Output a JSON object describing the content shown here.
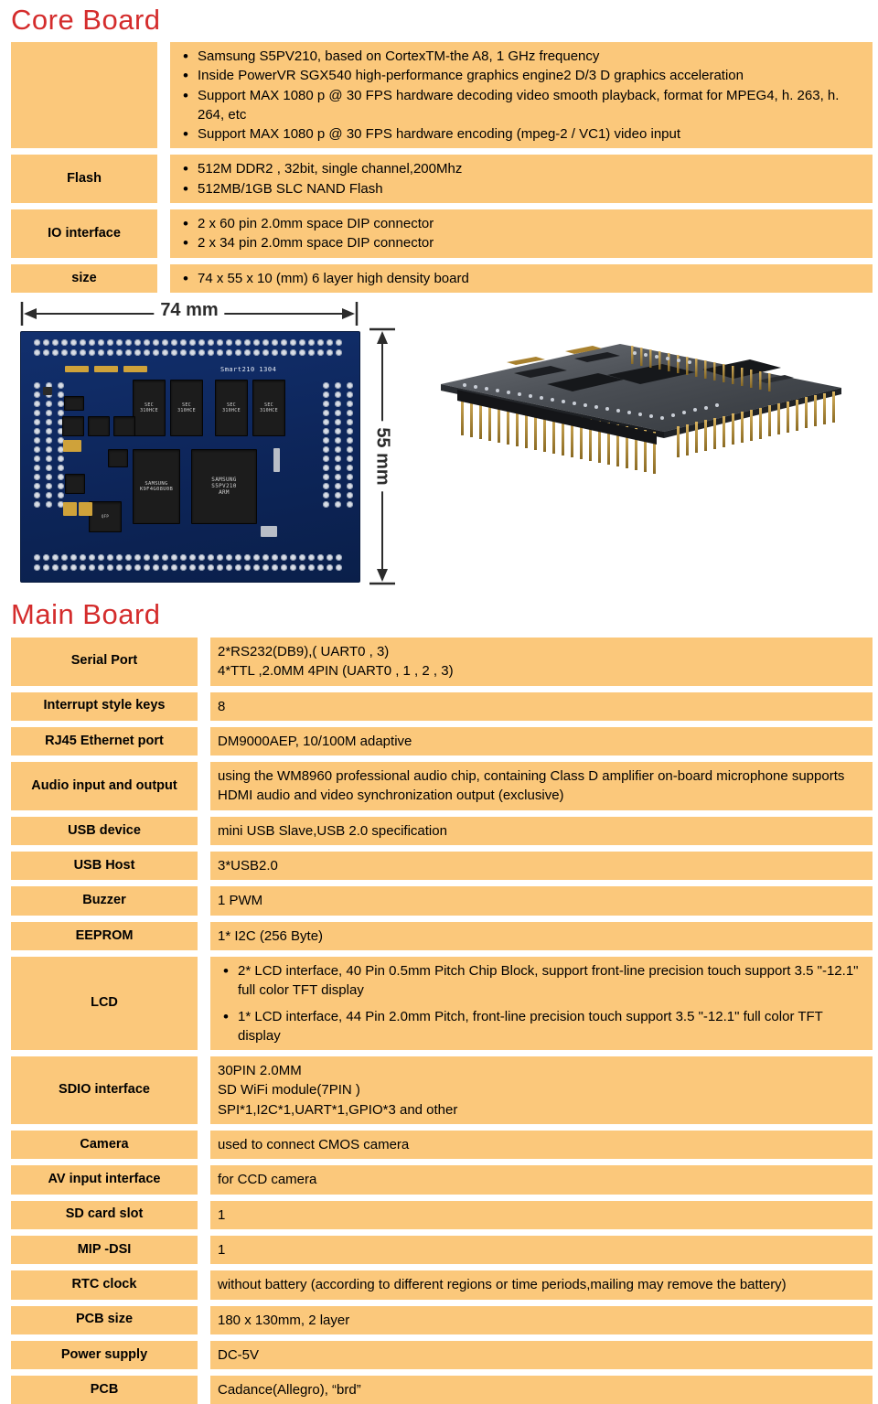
{
  "core_board": {
    "title": "Core Board",
    "rows": [
      {
        "label": "",
        "bullets": [
          "Samsung S5PV210, based on CortexTM-the A8, 1 GHz frequency",
          "Inside PowerVR SGX540 high-performance graphics engine2 D/3 D graphics acceleration",
          "Support MAX 1080 p @ 30 FPS hardware decoding video smooth playback, format for MPEG4, h. 263, h. 264, etc",
          "Support MAX 1080 p @ 30 FPS hardware encoding (mpeg-2 / VC1) video input"
        ]
      },
      {
        "label": "Flash",
        "bullets": [
          "512M DDR2 , 32bit, single channel,200Mhz",
          "512MB/1GB SLC NAND Flash"
        ]
      },
      {
        "label": "IO interface",
        "bullets": [
          "2 x 60 pin 2.0mm space DIP connector",
          "2 x 34 pin 2.0mm space DIP connector"
        ]
      },
      {
        "label": "size",
        "bullets": [
          "74 x 55 x 10 (mm)  6 layer high density board"
        ]
      }
    ]
  },
  "figure": {
    "width_dimension": "74 mm",
    "height_dimension": "55 mm",
    "silkscreen": "Smart210 1304",
    "chip_labels": {
      "nand": "SAMSUNG 140\nK9F4G08U0B\nPIB0",
      "cpu": "SAMSUNG\nS5PV210AH-A0\n1236\n602HMS\nARM",
      "ddr": "SEC 310 HCE\nK4T1G084QF"
    }
  },
  "main_board": {
    "title": "Main Board",
    "rows": [
      {
        "label": "Serial Port",
        "lines": [
          "2*RS232(DB9),( UART0 , 3)",
          "4*TTL ,2.0MM 4PIN (UART0 , 1 , 2 , 3)"
        ],
        "type": "plain"
      },
      {
        "label": "Interrupt style keys",
        "lines": [
          "8"
        ],
        "type": "plain"
      },
      {
        "label": "RJ45 Ethernet port",
        "lines": [
          "DM9000AEP, 10/100M adaptive"
        ],
        "type": "plain"
      },
      {
        "label": "Audio input and output",
        "lines": [
          "using the WM8960 professional audio chip, containing Class D amplifier on-board microphone supports HDMI audio and video synchronization output (exclusive)"
        ],
        "type": "plain"
      },
      {
        "label": "USB device",
        "lines": [
          "mini USB Slave,USB 2.0 specification"
        ],
        "type": "plain"
      },
      {
        "label": "USB Host",
        "lines": [
          "3*USB2.0"
        ],
        "type": "plain"
      },
      {
        "label": "Buzzer",
        "lines": [
          "1 PWM"
        ],
        "type": "plain"
      },
      {
        "label": "EEPROM",
        "lines": [
          "1* I2C (256 Byte)"
        ],
        "type": "plain"
      },
      {
        "label": "LCD",
        "lines": [
          "2* LCD interface, 40 Pin 0.5mm Pitch Chip Block, support front-line precision touch support 3.5 \"-12.1\" full color TFT display",
          "1* LCD interface, 44 Pin 2.0mm Pitch, front-line precision touch support 3.5 \"-12.1\" full color TFT display"
        ],
        "type": "bullets"
      },
      {
        "label": "SDIO interface",
        "lines": [
          "30PIN 2.0MM",
          "SD WiFi module(7PIN )",
          "SPI*1,I2C*1,UART*1,GPIO*3 and other"
        ],
        "type": "plain"
      },
      {
        "label": "Camera",
        "lines": [
          "used to connect CMOS camera"
        ],
        "type": "plain"
      },
      {
        "label": "AV input interface",
        "lines": [
          "for CCD camera"
        ],
        "type": "plain"
      },
      {
        "label": "SD card slot",
        "lines": [
          "1"
        ],
        "type": "plain"
      },
      {
        "label": "MIP -DSI",
        "lines": [
          "1"
        ],
        "type": "plain"
      },
      {
        "label": "RTC clock",
        "lines": [
          "without battery (according to different regions or time periods,mailing may remove the battery)"
        ],
        "type": "plain"
      },
      {
        "label": "PCB size",
        "lines": [
          "180 x 130mm, 2 layer"
        ],
        "type": "plain"
      },
      {
        "label": "Power supply",
        "lines": [
          "DC-5V"
        ],
        "type": "plain"
      },
      {
        "label": "PCB",
        "lines": [
          "Cadance(Allegro),   “brd”"
        ],
        "type": "plain"
      }
    ]
  },
  "colors": {
    "cell_background": "#fbc87b",
    "title_red": "#d42c2c",
    "text_black": "#000000",
    "pcb_blue": "#0d2559",
    "page_background": "#ffffff"
  }
}
